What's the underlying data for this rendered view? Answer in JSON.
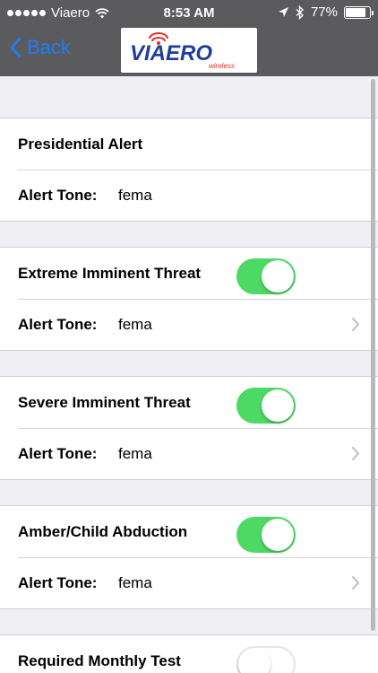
{
  "status": {
    "carrier": "Viaero",
    "time": "8:53 AM",
    "battery": "77%"
  },
  "nav": {
    "back_label": "Back",
    "logo_main": "VIAERO",
    "logo_sub": "wireless"
  },
  "sections": [
    {
      "title": "Presidential Alert",
      "toggle": null,
      "tone_label": "Alert Tone:",
      "tone_value": "fema",
      "chevron": false
    },
    {
      "title": "Extreme Imminent Threat",
      "toggle": "on",
      "tone_label": "Alert Tone:",
      "tone_value": "fema",
      "chevron": true
    },
    {
      "title": "Severe Imminent Threat",
      "toggle": "on",
      "tone_label": "Alert Tone:",
      "tone_value": "fema",
      "chevron": true
    },
    {
      "title": "Amber/Child Abduction",
      "toggle": "on",
      "tone_label": "Alert Tone:",
      "tone_value": "fema",
      "chevron": true
    },
    {
      "title": "Required Monthly Test",
      "toggle": "off"
    }
  ],
  "colors": {
    "nav_background": "#5b5b5e",
    "accent": "#1f7cf2",
    "toggle_on": "#4cd964",
    "page_background": "#efeff4"
  }
}
